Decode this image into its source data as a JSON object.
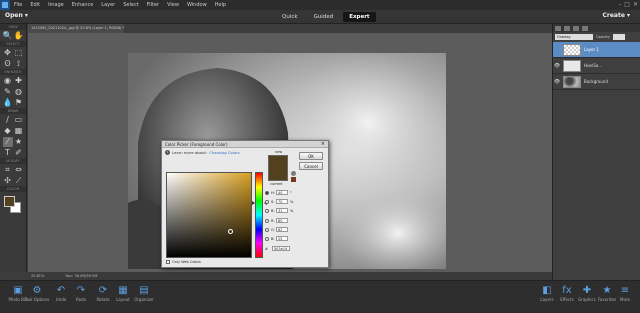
{
  "menubar": {
    "items": [
      "File",
      "Edit",
      "Image",
      "Enhance",
      "Layer",
      "Select",
      "Filter",
      "View",
      "Window",
      "Help"
    ],
    "window_controls": [
      "–",
      "□",
      "✕"
    ]
  },
  "modebar": {
    "open_label": "Open ▾",
    "tabs": [
      {
        "label": "Quick"
      },
      {
        "label": "Guided"
      },
      {
        "label": "Expert"
      }
    ],
    "create_label": "Create ▾"
  },
  "toolbox": {
    "sections": {
      "view": "VIEW",
      "select": "SELECT",
      "enhance": "ENHANCE",
      "draw": "DRAW",
      "modify": "MODIFY",
      "color": "COLOR"
    },
    "icons": {
      "zoom": "🔍",
      "hand": "✋",
      "move": "✥",
      "marquee": "⬚",
      "lasso": "ʘ",
      "quick_select": "⟟",
      "eye": "◉",
      "spot_heal": "✚",
      "smart_brush": "✎",
      "sponge": "◍",
      "blur": "💧",
      "clone": "⚑",
      "brush": "∕",
      "eraser": "▭",
      "paint_bucket": "◆",
      "gradient": "▦",
      "color_picker": "⁄",
      "shape": "★",
      "type": "T",
      "pencil": "✐",
      "crop": "⌗",
      "recompose": "⇔",
      "content_move": "✣",
      "straighten": "⟋"
    },
    "fg_color": "#53401c",
    "bg_color": "#ffffff"
  },
  "document": {
    "tab_label": "1415562_20211024_.jpg @ 20.6% (Layer 1, RGB/8) *",
    "zoom": "20.61%",
    "doc_size": "Doc: 36.0M/59.5M"
  },
  "layers_panel": {
    "blend_mode": "Overlay",
    "opacity_label": "Opacity:",
    "layers": [
      {
        "name": "Layer 1",
        "thumb": "checker",
        "selected": true,
        "visible": ""
      },
      {
        "name": "Hue/Sa...",
        "thumb": "adj",
        "selected": false,
        "visible": "👁"
      },
      {
        "name": "Background",
        "thumb": "photo",
        "selected": false,
        "visible": "👁"
      }
    ]
  },
  "bottombar": {
    "items": [
      {
        "label": "Photo Bin",
        "icon": "▣"
      },
      {
        "label": "Tool Options",
        "icon": "⚙"
      },
      {
        "label": "Undo",
        "icon": "↶"
      },
      {
        "label": "Redo",
        "icon": "↷"
      },
      {
        "label": "Rotate",
        "icon": "⟳"
      },
      {
        "label": "Layout",
        "icon": "▦"
      },
      {
        "label": "Organizer",
        "icon": "▤"
      },
      {
        "label": "Layers",
        "icon": "◧"
      },
      {
        "label": "Effects",
        "icon": "fx"
      },
      {
        "label": "Graphics",
        "icon": "✚"
      },
      {
        "label": "Favorites",
        "icon": "★"
      },
      {
        "label": "More",
        "icon": "≡"
      }
    ]
  },
  "dialog": {
    "title": "Color Picker (Foreground Color)",
    "learn_more": "Learn more about:",
    "learn_link": "Choosing Colors",
    "new_label": "new",
    "current_label": "current",
    "ok_label": "OK",
    "cancel_label": "Cancel",
    "fields": [
      {
        "label": "H:",
        "value": "40",
        "unit": "°",
        "selected": true
      },
      {
        "label": "S:",
        "value": "70",
        "unit": "%",
        "selected": false
      },
      {
        "label": "B:",
        "value": "31",
        "unit": "%",
        "selected": false
      },
      {
        "label": "R:",
        "value": "80",
        "unit": "",
        "selected": false
      },
      {
        "label": "G:",
        "value": "62",
        "unit": "",
        "selected": false
      },
      {
        "label": "B:",
        "value": "25",
        "unit": "",
        "selected": false
      }
    ],
    "hex": "#",
    "hex_value": "503e19",
    "only_web_colors": "Only Web Colors",
    "new_color": "#53401c",
    "hue_color": "#d79f21"
  },
  "colors": {
    "accent": "#5b8dc4"
  }
}
